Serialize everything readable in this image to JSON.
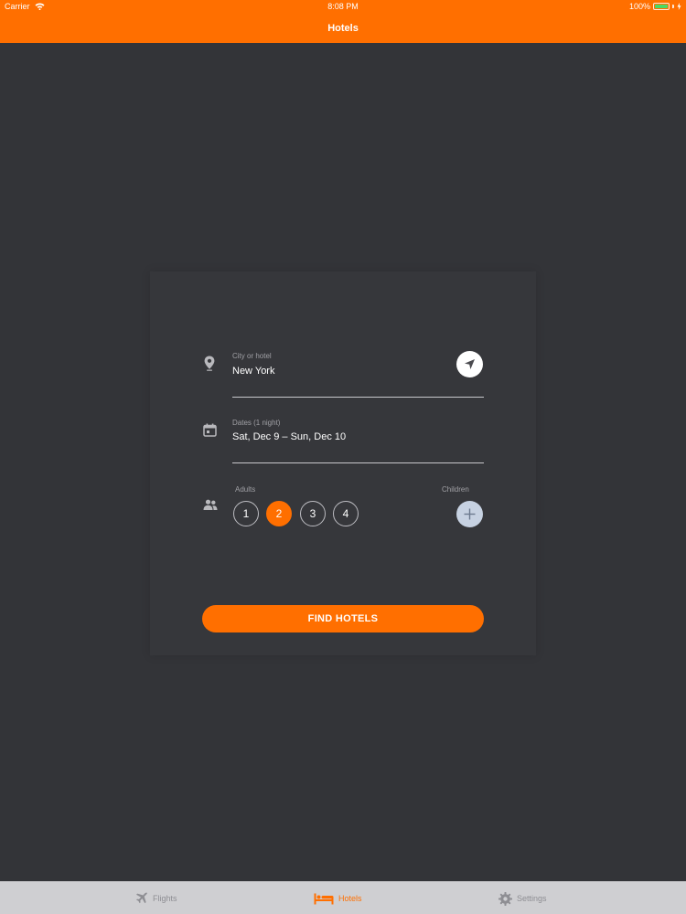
{
  "status_bar": {
    "carrier": "Carrier",
    "time": "8:08 PM",
    "battery": "100%"
  },
  "nav": {
    "title": "Hotels"
  },
  "search": {
    "city_label": "City or hotel",
    "city_value": "New York",
    "dates_label": "Dates (1 night)",
    "dates_value": "Sat, Dec 9 – Sun, Dec 10",
    "adults_label": "Adults",
    "children_label": "Children",
    "adults_options": [
      "1",
      "2",
      "3",
      "4"
    ],
    "adults_selected": "2",
    "find_button": "FIND HOTELS"
  },
  "tabs": [
    {
      "label": "Flights",
      "icon": "airplane-icon"
    },
    {
      "label": "Hotels",
      "icon": "bed-icon"
    },
    {
      "label": "Settings",
      "icon": "gear-icon"
    }
  ],
  "colors": {
    "accent": "#ff6f00",
    "background": "#333438",
    "tab_bar": "#cfcfd2"
  }
}
